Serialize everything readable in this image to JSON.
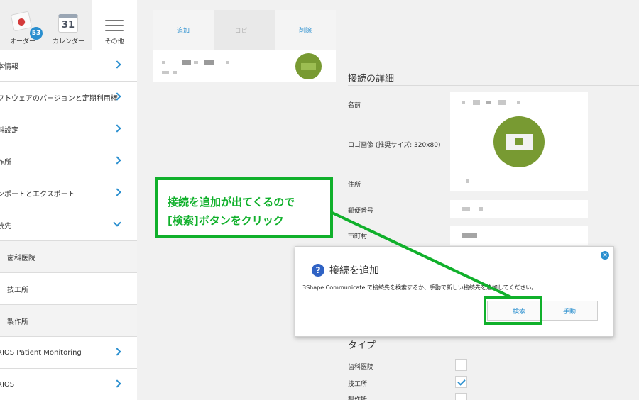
{
  "topbar": {
    "orders": {
      "label": "オーダー",
      "badge": "53"
    },
    "calendar": {
      "label": "カレンダー",
      "day": "31"
    },
    "other": {
      "label": "その他"
    }
  },
  "sidebar": {
    "items": [
      {
        "label": "本情報"
      },
      {
        "label": "フトウェアのバージョンと定期利用権"
      },
      {
        "label": "料設定"
      },
      {
        "label": "作所"
      },
      {
        "label": "ンポートとエクスポート"
      },
      {
        "label": "続先"
      }
    ],
    "sub_items": [
      {
        "label": "歯科医院"
      },
      {
        "label": "技工所"
      },
      {
        "label": "製作所"
      }
    ],
    "bottom_items": [
      {
        "label": "RIOS Patient Monitoring"
      },
      {
        "label": "RIOS"
      }
    ]
  },
  "connections": {
    "toolbar": {
      "add": "追加",
      "copy": "コピー",
      "delete": "削除"
    }
  },
  "details": {
    "title": "接続の詳細",
    "name_label": "名前",
    "logo_label": "ロゴ画像 (推奨サイズ: 320x80)",
    "address_label": "住所",
    "postal_label": "郵便番号",
    "city_label": "市町村"
  },
  "type_section": {
    "title": "タイプ",
    "options": [
      {
        "label": "歯科医院",
        "checked": false
      },
      {
        "label": "技工所",
        "checked": true
      },
      {
        "label": "製作所",
        "checked": false
      }
    ]
  },
  "dialog": {
    "title": "接続を追加",
    "message": "3Shape Communicate で接続先を検索するか、手動で新しい接続先を追加してください。",
    "search_button": "検索",
    "manual_button": "手動",
    "close": "×",
    "help": "?"
  },
  "annotation": {
    "line1": "接続を追加が出てくるので",
    "line2": "[検索]ボタンをクリック"
  },
  "colors": {
    "accent": "#2a8fcf",
    "annotation_green": "#10b02b",
    "logo_green": "#789a32"
  }
}
